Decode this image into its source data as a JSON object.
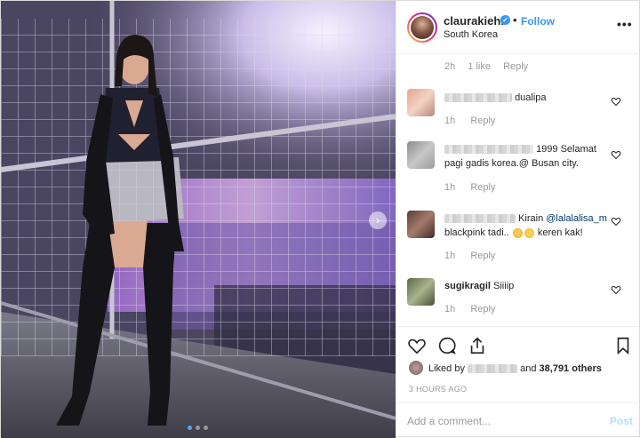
{
  "post": {
    "carousel": {
      "slides": 3,
      "active": 1,
      "next_glyph": "›"
    }
  },
  "header": {
    "username": "claurakiehl",
    "verified_glyph": "✓",
    "separator": "•",
    "follow_label": "Follow",
    "location": "South Korea",
    "more_glyph": "•••"
  },
  "top_meta": {
    "time": "2h",
    "likes": "1 like",
    "reply": "Reply"
  },
  "comments": [
    {
      "text": "dualipa",
      "time": "1h",
      "reply": "Reply"
    },
    {
      "text_line1": "1999 Selamat",
      "text_line2": "pagi gadis korea.@ Busan city.",
      "time": "1h",
      "reply": "Reply"
    },
    {
      "text": "Kirain",
      "mention": "@lalalalisa_m",
      "text_line2a": "blackpink tadi..",
      "text_line2b": "keren kak!",
      "time": "1h",
      "reply": "Reply"
    },
    {
      "username": "sugikragil",
      "text": "Siiiip",
      "time": "1h",
      "reply": "Reply"
    }
  ],
  "likes": {
    "prefix": "Liked by",
    "and": "and",
    "count": "38,791 others"
  },
  "time_ago": "3 HOURS AGO",
  "add_comment": {
    "placeholder": "Add a comment...",
    "post_label": "Post"
  },
  "colors": {
    "accent": "#3897f0",
    "post_disabled": "#b2dffc",
    "muted": "#999999"
  }
}
